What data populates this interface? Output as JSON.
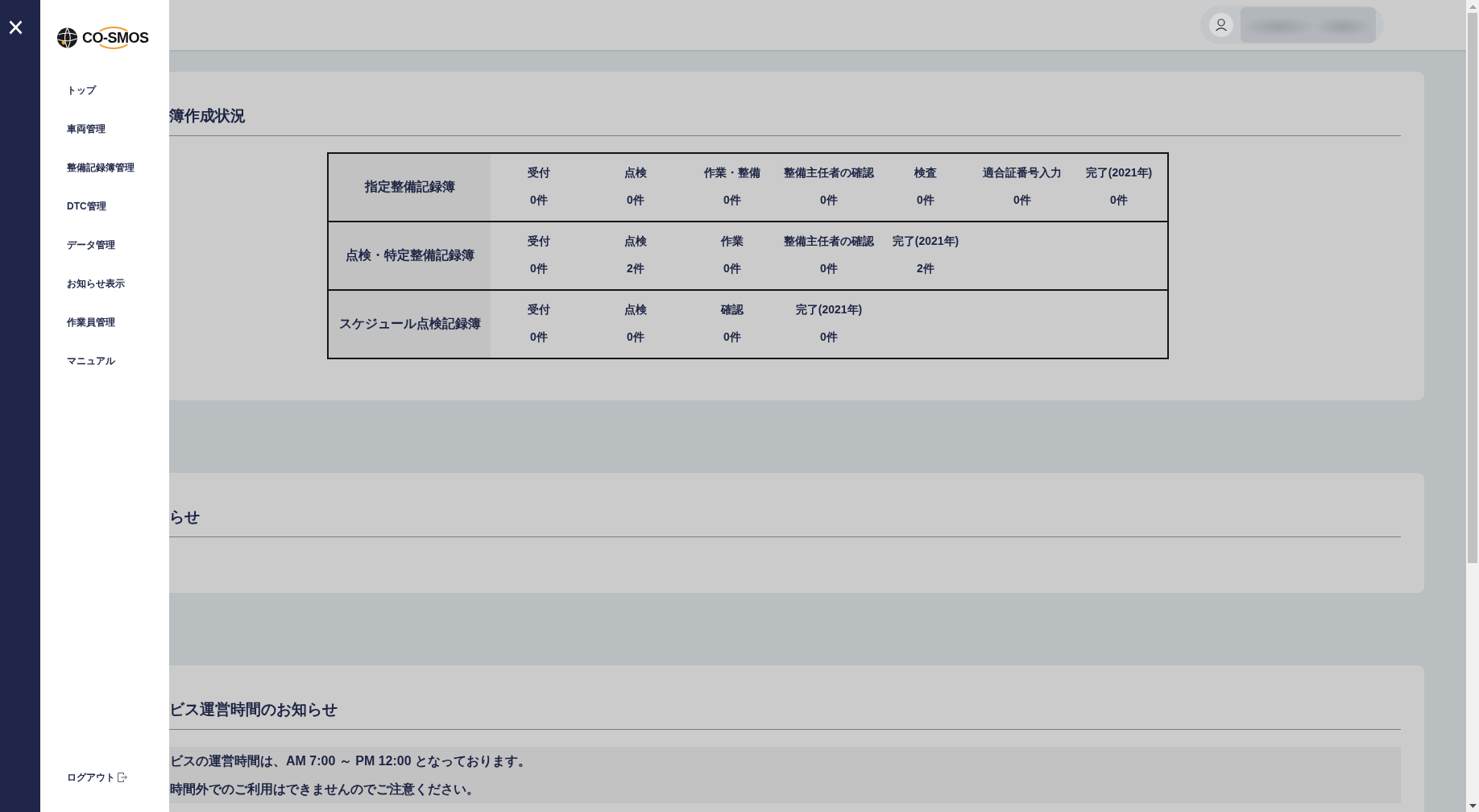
{
  "sidebar": {
    "logo": {
      "text": "CO-SMOS"
    },
    "items": [
      {
        "label": "トップ"
      },
      {
        "label": "車両管理"
      },
      {
        "label": "整備記録簿管理"
      },
      {
        "label": "DTC管理"
      },
      {
        "label": "データ管理"
      },
      {
        "label": "お知らせ表示"
      },
      {
        "label": "作業員管理"
      },
      {
        "label": "マニュアル"
      }
    ],
    "logout": {
      "label": "ログアウト"
    }
  },
  "sections": [
    {
      "kind": "status_table",
      "title": "簿作成状況",
      "rows": [
        {
          "label": "指定整備記録簿",
          "stages": [
            {
              "label": "受付",
              "count": "0件"
            },
            {
              "label": "点検",
              "count": "0件"
            },
            {
              "label": "作業・整備",
              "count": "0件"
            },
            {
              "label": "整備主任者の確認",
              "count": "0件"
            },
            {
              "label": "検査",
              "count": "0件"
            },
            {
              "label": "適合証番号入力",
              "count": "0件"
            },
            {
              "label": "完了(2021年)",
              "count": "0件"
            }
          ]
        },
        {
          "label": "点検・特定整備記録簿",
          "stages": [
            {
              "label": "受付",
              "count": "0件"
            },
            {
              "label": "点検",
              "count": "2件"
            },
            {
              "label": "作業",
              "count": "0件"
            },
            {
              "label": "整備主任者の確認",
              "count": "0件"
            },
            {
              "label": "完了(2021年)",
              "count": "2件"
            }
          ]
        },
        {
          "label": "スケジュール点検記録簿",
          "stages": [
            {
              "label": "受付",
              "count": "0件"
            },
            {
              "label": "点検",
              "count": "0件"
            },
            {
              "label": "確認",
              "count": "0件"
            },
            {
              "label": "完了(2021年)",
              "count": "0件"
            }
          ]
        }
      ]
    },
    {
      "kind": "notices",
      "title": "らせ"
    },
    {
      "kind": "message",
      "title": "ビス運営時間のお知らせ",
      "lines": [
        "ビスの運営時間は、AM 7:00 ～ PM 12:00 となっております。",
        "時間外でのご利用はできませんのでご注意ください。"
      ]
    }
  ]
}
